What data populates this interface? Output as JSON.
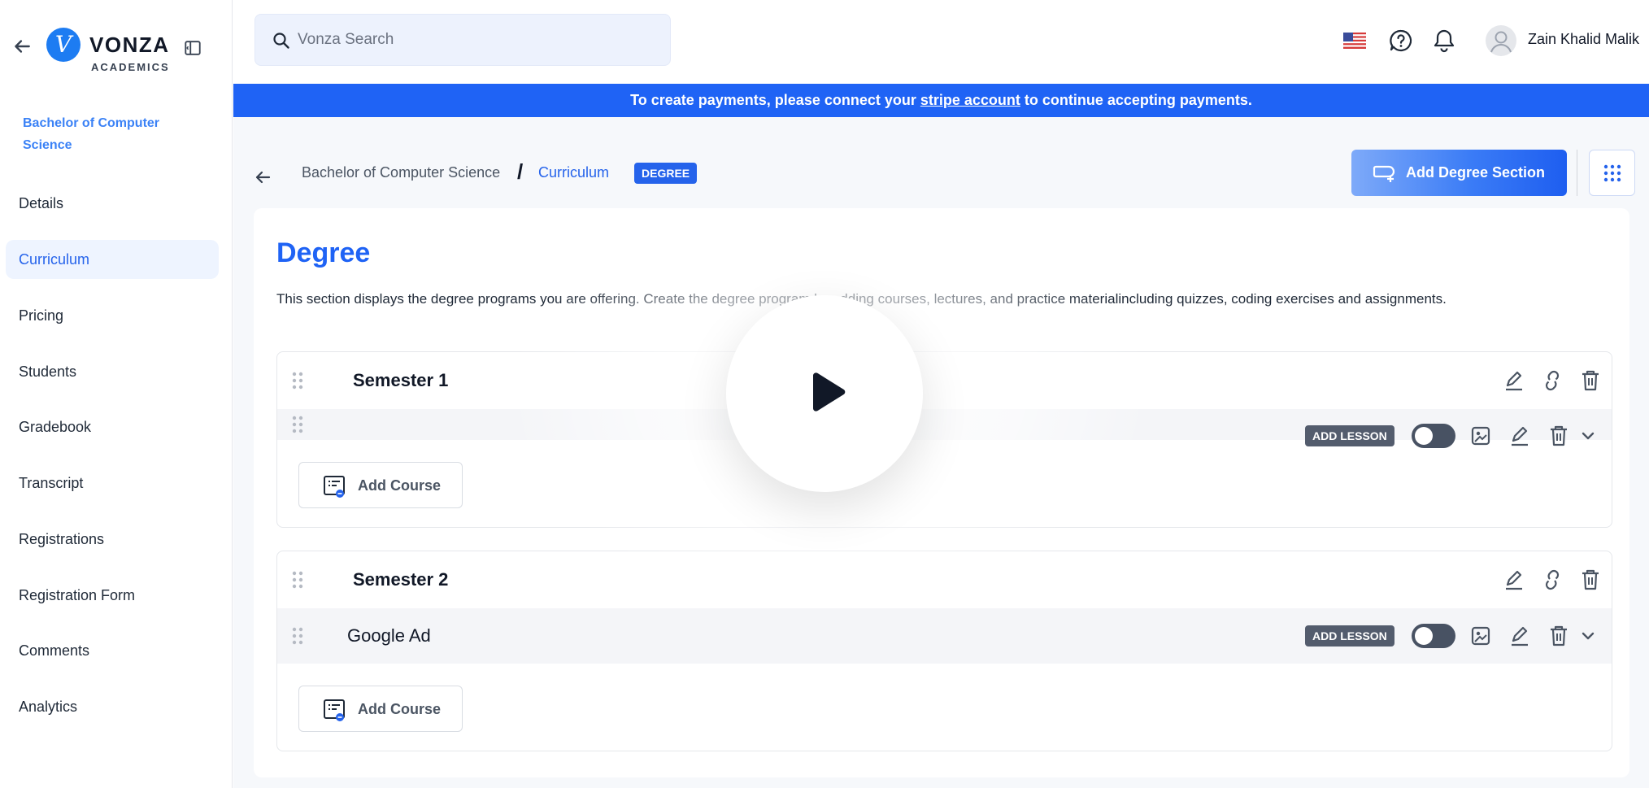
{
  "brand": {
    "logo_letter": "V",
    "name": "VONZA",
    "sub": "ACADEMICS"
  },
  "sidebar": {
    "course_title": "Bachelor of Computer Science",
    "items": [
      {
        "label": "Details"
      },
      {
        "label": "Curriculum",
        "active": true
      },
      {
        "label": "Pricing"
      },
      {
        "label": "Students"
      },
      {
        "label": "Gradebook"
      },
      {
        "label": "Transcript"
      },
      {
        "label": "Registrations"
      },
      {
        "label": "Registration Form"
      },
      {
        "label": "Comments"
      },
      {
        "label": "Analytics"
      }
    ]
  },
  "header": {
    "search_placeholder": "Vonza Search",
    "user_name": "Zain Khalid Malik",
    "icons": [
      "us-flag-icon",
      "help-icon",
      "bell-icon",
      "avatar"
    ]
  },
  "banner": {
    "text_before": "To create payments, please connect your ",
    "link": "stripe account",
    "text_after": " to continue accepting payments."
  },
  "breadcrumb": {
    "item1": "Bachelor of Computer Science",
    "separator": "/",
    "item2": "Curriculum",
    "badge": "DEGREE"
  },
  "actions": {
    "add_section": "Add Degree Section"
  },
  "degree": {
    "title": "Degree",
    "description": "This section displays the degree programs you are offering. Create the degree program by adding courses, lectures, and practice materialincluding quizzes, coding exercises and assignments.",
    "semesters": [
      {
        "title": "Semester 1",
        "course": {
          "name": "",
          "add_lesson": "ADD LESSON"
        },
        "add_course": "Add Course"
      },
      {
        "title": "Semester 2",
        "course": {
          "name": "Google Ad",
          "add_lesson": "ADD LESSON"
        },
        "add_course": "Add Course"
      }
    ]
  },
  "colors": {
    "primary": "#1f63f5",
    "accent": "#2563eb",
    "badge_dark": "#535c6d",
    "toggle_off": "#485263"
  }
}
